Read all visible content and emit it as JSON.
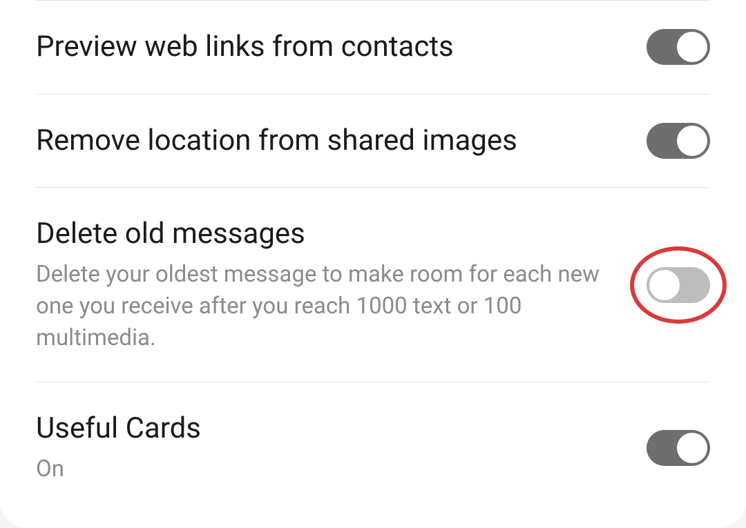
{
  "settings": [
    {
      "title": "Preview web links from contacts",
      "subtitle": "",
      "toggle": "on",
      "highlighted": false
    },
    {
      "title": "Remove location from shared images",
      "subtitle": "",
      "toggle": "on",
      "highlighted": false
    },
    {
      "title": "Delete old messages",
      "subtitle": "Delete your oldest message to make room for each new one you receive after you reach 1000 text or 100 multimedia.",
      "toggle": "off",
      "highlighted": true
    },
    {
      "title": "Useful Cards",
      "subtitle": "On",
      "toggle": "on",
      "highlighted": false
    }
  ]
}
